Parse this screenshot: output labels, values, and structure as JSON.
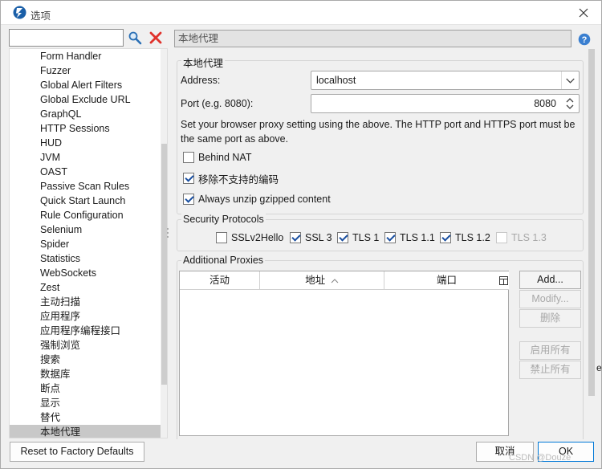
{
  "window": {
    "title": "选项",
    "edge_char": "e"
  },
  "sidebar": {
    "search_placeholder": "",
    "items": [
      "Form Handler",
      "Fuzzer",
      "Global Alert Filters",
      "Global Exclude URL",
      "GraphQL",
      "HTTP Sessions",
      "HUD",
      "JVM",
      "OAST",
      "Passive Scan Rules",
      "Quick Start Launch",
      "Rule Configuration",
      "Selenium",
      "Spider",
      "Statistics",
      "WebSockets",
      "Zest",
      "主动扫描",
      "应用程序",
      "应用程序编程接口",
      "强制浏览",
      "搜索",
      "数据库",
      "断点",
      "显示",
      "替代",
      "本地代理"
    ],
    "selected": "本地代理"
  },
  "panel": {
    "title": "本地代理"
  },
  "proxy": {
    "group_label": "本地代理",
    "address_label": "Address:",
    "address_value": "localhost",
    "port_label": "Port (e.g. 8080):",
    "port_value": "8080",
    "info": "Set your browser proxy setting using the above.  The HTTP port and HTTPS port must be the same port as above.",
    "info_line1": "Set your browser proxy setting using the above.  The HTTP port and HTTPS port must be",
    "info_line2": "the same port as above.",
    "behind_nat": "Behind NAT",
    "remove_encodings": "移除不支持的编码",
    "unzip": "Always unzip gzipped content"
  },
  "protocols": {
    "group_label": "Security Protocols",
    "items": [
      {
        "label": "SSLv2Hello",
        "checked": false,
        "enabled": true
      },
      {
        "label": "SSL 3",
        "checked": true,
        "enabled": true
      },
      {
        "label": "TLS 1",
        "checked": true,
        "enabled": true
      },
      {
        "label": "TLS 1.1",
        "checked": true,
        "enabled": true
      },
      {
        "label": "TLS 1.2",
        "checked": true,
        "enabled": true
      },
      {
        "label": "TLS 1.3",
        "checked": false,
        "enabled": false
      }
    ]
  },
  "proxies": {
    "group_label": "Additional Proxies",
    "columns": [
      "活动",
      "地址",
      "端口"
    ],
    "rows": [],
    "buttons": {
      "add": "Add...",
      "modify": "Modify...",
      "remove": "删除",
      "enable_all": "启用所有",
      "disable_all": "禁止所有"
    }
  },
  "footer": {
    "reset": "Reset to Factory Defaults",
    "cancel": "取消",
    "ok": "OK",
    "watermark": "CSDN @Douze"
  }
}
